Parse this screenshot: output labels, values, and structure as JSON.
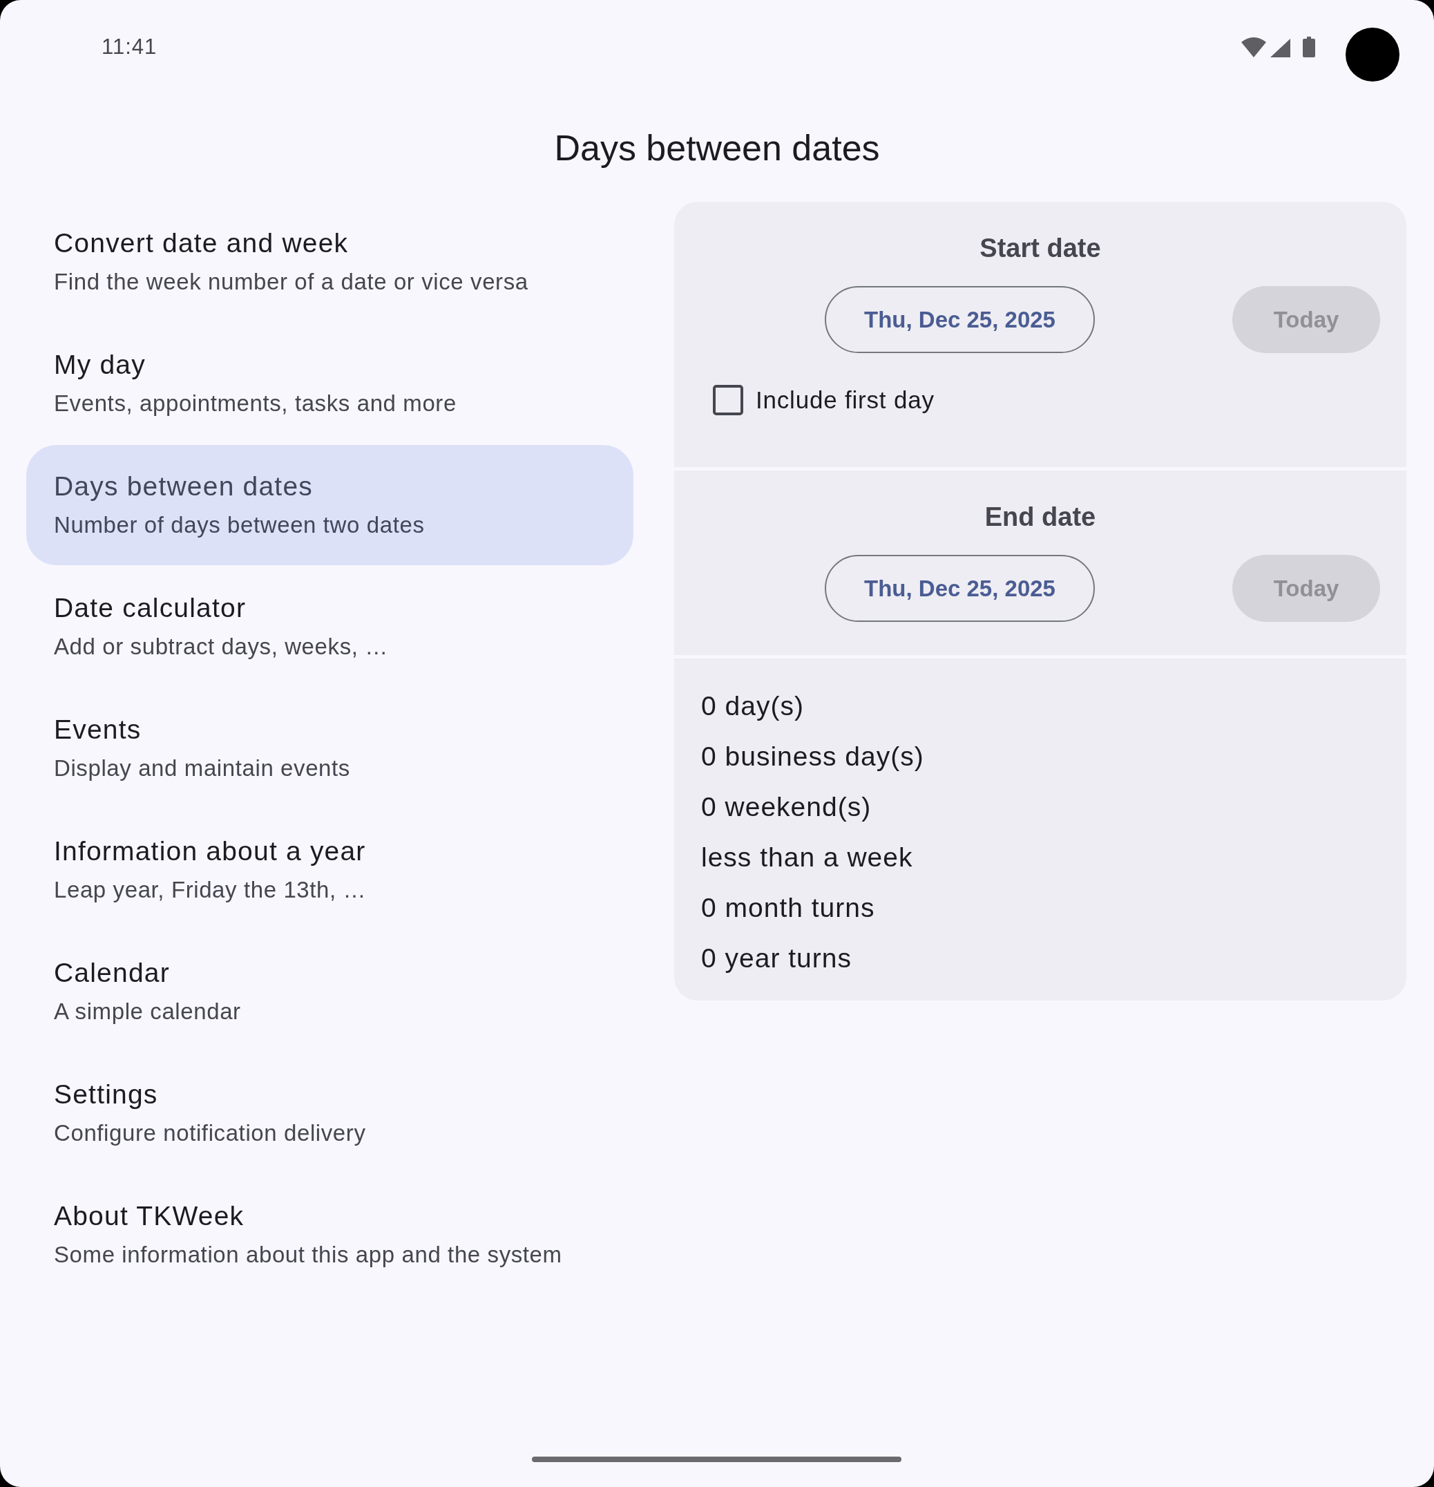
{
  "status_bar": {
    "time": "11:41"
  },
  "title": "Days between dates",
  "sidebar": {
    "items": [
      {
        "title": "Convert date and week",
        "subtitle": "Find the week number of a date or vice versa",
        "selected": false
      },
      {
        "title": "My day",
        "subtitle": "Events, appointments, tasks and more",
        "selected": false
      },
      {
        "title": "Days between dates",
        "subtitle": "Number of days between two dates",
        "selected": true
      },
      {
        "title": "Date calculator",
        "subtitle": "Add or subtract days, weeks, …",
        "selected": false
      },
      {
        "title": "Events",
        "subtitle": "Display and maintain events",
        "selected": false
      },
      {
        "title": "Information about a year",
        "subtitle": "Leap year, Friday the 13th, …",
        "selected": false
      },
      {
        "title": "Calendar",
        "subtitle": "A simple calendar",
        "selected": false
      },
      {
        "title": "Settings",
        "subtitle": "Configure notification delivery",
        "selected": false
      },
      {
        "title": "About TKWeek",
        "subtitle": "Some information about this app and the system",
        "selected": false
      }
    ]
  },
  "date_sections": [
    {
      "heading": "Start date",
      "date_button": "Thu, Dec 25, 2025",
      "today_button": {
        "label": "Today",
        "disabled": true
      },
      "include_first_day": {
        "label": "Include first day",
        "checked": false
      }
    },
    {
      "heading": "End date",
      "date_button": "Thu, Dec 25, 2025",
      "today_button": {
        "label": "Today",
        "disabled": true
      }
    }
  ],
  "results": [
    "0 day(s)",
    "0 business day(s)",
    "0 weekend(s)",
    "less than a week",
    "0 month turns",
    "0 year turns"
  ]
}
